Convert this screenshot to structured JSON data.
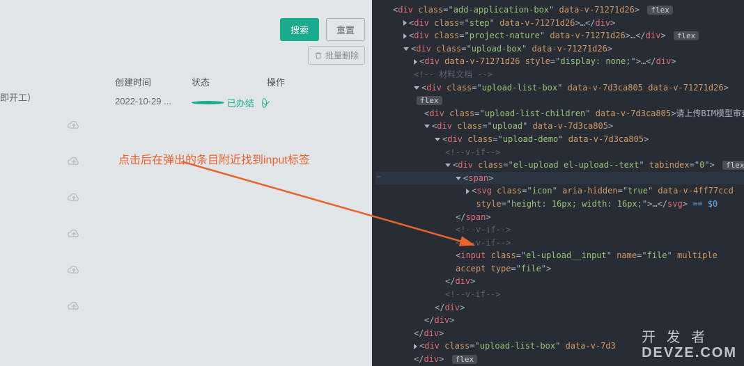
{
  "left": {
    "side_text": "即开工）",
    "btn_search": "搜索",
    "btn_reset": "重置",
    "batch_delete": "批量删除",
    "headers": {
      "h1": "创建时间",
      "h2": "状态",
      "h3": "操作"
    },
    "row": {
      "date": "2022-10-29 ...",
      "status": "已办结"
    },
    "annotation": "点击后在弹出的条目附近找到input标签"
  },
  "dev": {
    "line1_cls": "add-application-box",
    "line1_dv": "data-v-71271d26",
    "line2_cls": "step",
    "line3_cls": "project-nature",
    "line4_cls": "upload-box",
    "line5_style": "display: none;",
    "line6_comment": " 材料文档 ",
    "line7_cls": "upload-list-box",
    "line7_dv2": "data-v-7d3ca805",
    "line8_cls": "upload-list-children",
    "line8_text": "请上传BIM模型审查申请表",
    "line9_cls": "upload",
    "line10_cls": "upload-demo",
    "line11_vif": "v-if",
    "line12_cls": "el-upload el-upload--text",
    "line12_tab": "0",
    "span_tag": "span",
    "svg_cls": "icon",
    "svg_aria": "true",
    "svg_dv": "data-v-4ff77ccd",
    "svg_style": "height: 16px; width: 16px;",
    "svg_eq": " == $0",
    "input_cls": "el-upload__input",
    "input_name": "file",
    "input_multiple": "multiple",
    "input_accept": "accept",
    "input_type": "file",
    "flex_badge": "flex"
  },
  "watermark": {
    "cn": "开 发 者",
    "en": "DEVZE.COM"
  }
}
